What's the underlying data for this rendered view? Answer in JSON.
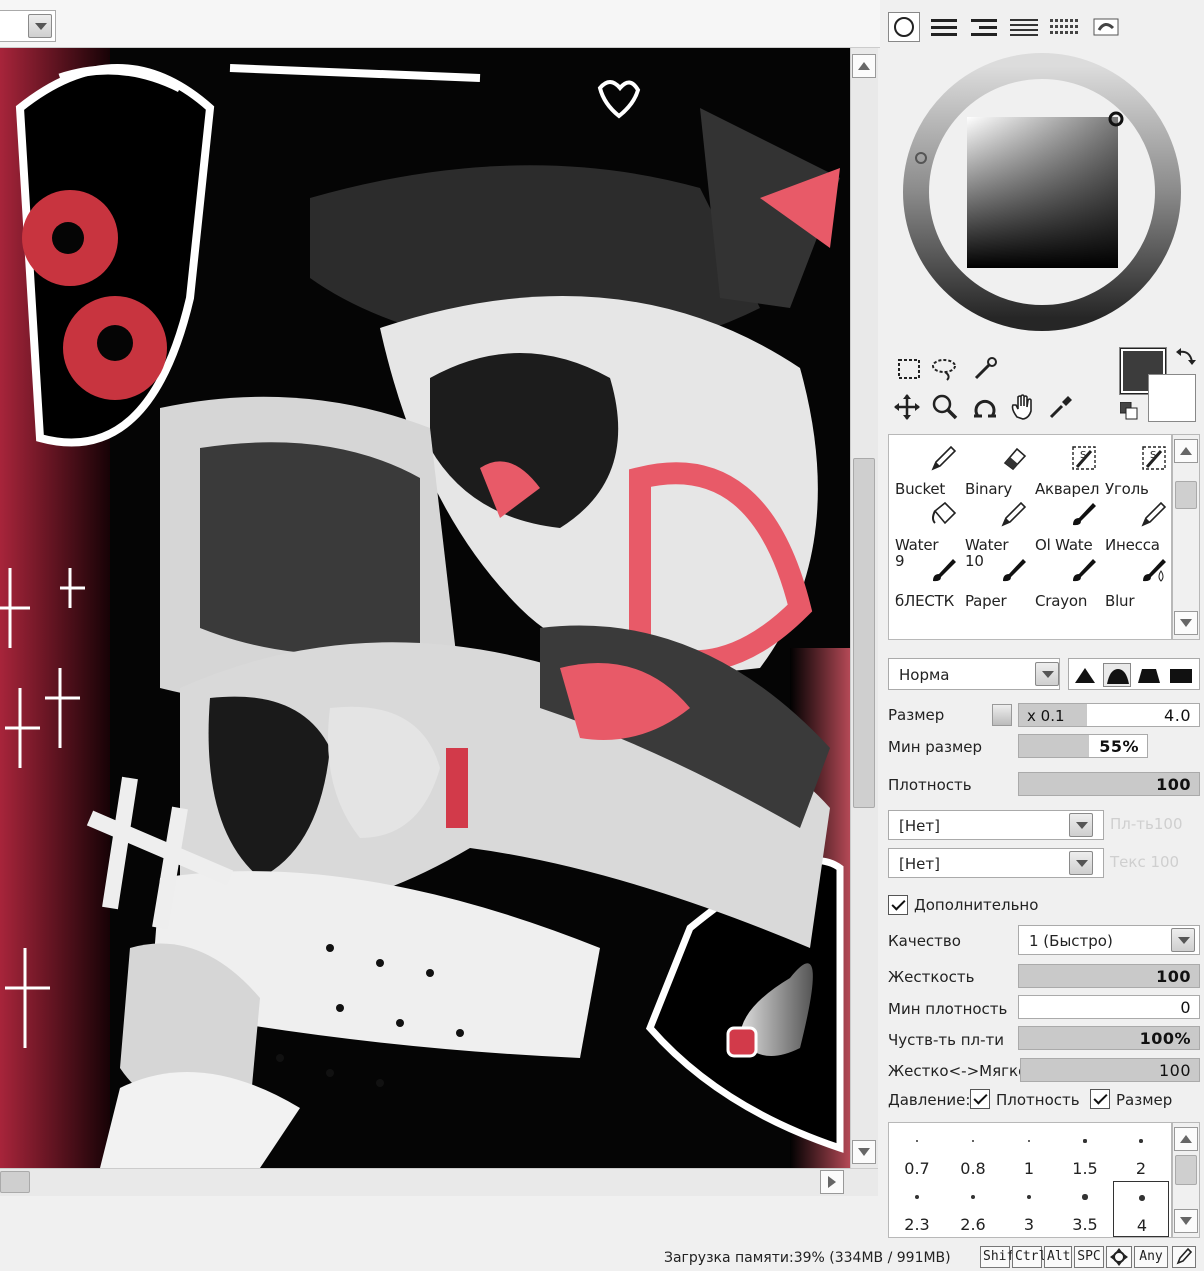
{
  "panel": {
    "brushes": [
      {
        "label": "Bucket"
      },
      {
        "label": "Binary"
      },
      {
        "label": "Акварел"
      },
      {
        "label": "Уголь"
      },
      {
        "label": "Water\n9"
      },
      {
        "label": "Water\n10"
      },
      {
        "label": "Ol Wate"
      },
      {
        "label": "Инесса"
      },
      {
        "label": "бЛЕСТК"
      },
      {
        "label": "Paper"
      },
      {
        "label": "Crayon"
      },
      {
        "label": "Blur"
      }
    ],
    "blend_mode": "Норма",
    "size_label": "Размер",
    "size_multiplier": "x 0.1",
    "size_value": "4.0",
    "min_size_label": "Мин размер",
    "min_size_value": "55%",
    "min_size_level": 0.55,
    "density_label": "Плотность",
    "density_value": "100",
    "texture1": "[Нет]",
    "texture1_ghost": "Пл-ть100",
    "texture2": "[Нет]",
    "texture2_ghost": "Текс 100",
    "advanced_label": "Дополнительно",
    "quality_label": "Качество",
    "quality_value": "1 (Быстро)",
    "hardness_label": "Жесткость",
    "hardness_value": "100",
    "min_density_label": "Мин плотность",
    "min_density_value": "0",
    "sensitivity_label": "Чуств-ть пл-ти",
    "sensitivity_value": "100%",
    "hard_soft_label": "Жестко<->Мягко",
    "hard_soft_value": "100",
    "pressure_label": "Давление:",
    "pressure_density_label": "Плотность",
    "pressure_size_label": "Размер",
    "sizes": [
      "0.7",
      "0.8",
      "1",
      "1.5",
      "2",
      "2.3",
      "2.6",
      "3",
      "3.5",
      "4"
    ],
    "selected_size": "4"
  },
  "status": {
    "memory": "Загрузка памяти:39% (334MB / 991MB)",
    "keys": [
      "Shift",
      "Ctrl",
      "Alt",
      "SPC",
      "Any"
    ]
  },
  "colors": {
    "foreground": "#3c3c3c",
    "background": "#ffffff",
    "accent_red": "#e85a68"
  },
  "icons": [
    "brush-circle-tab-icon",
    "list-tab-icon",
    "select-rect-icon",
    "lasso-icon",
    "magic-wand-icon",
    "move-icon",
    "zoom-icon",
    "rotate-icon",
    "hand-icon",
    "eyedropper-icon"
  ]
}
